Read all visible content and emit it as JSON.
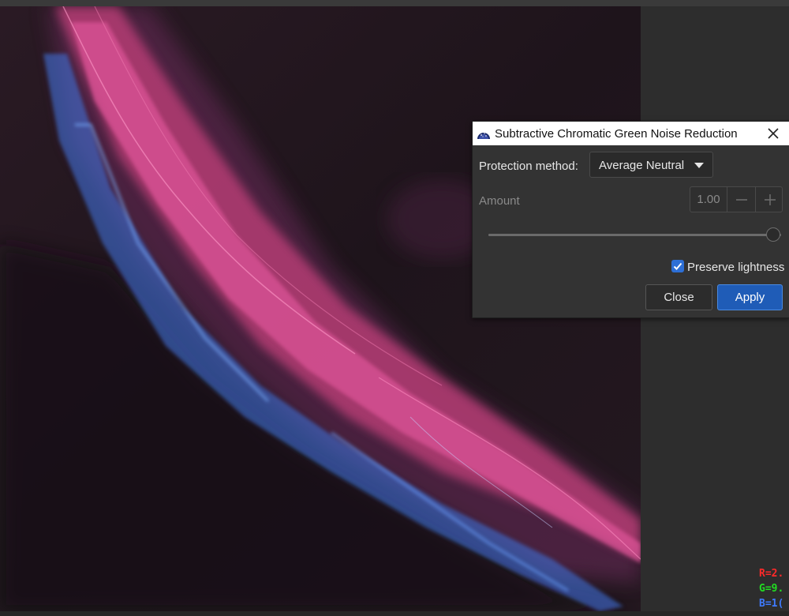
{
  "dialog": {
    "title": "Subtractive Chromatic Green Noise Reduction",
    "protection_label": "Protection method:",
    "protection_value": "Average Neutral",
    "amount_label": "Amount",
    "amount_value": "1.00",
    "amount_slider_fraction": 1.0,
    "preserve_label": "Preserve lightness",
    "preserve_checked": true,
    "close_label": "Close",
    "apply_label": "Apply"
  },
  "readout": {
    "r": "R=2.",
    "g": "G=9.",
    "b": "B=1(",
    "r_color": "#ff2a2a",
    "g_color": "#22dd22",
    "b_color": "#3f7bff"
  },
  "colors": {
    "accent": "#2d6fd6",
    "apply_button": "#1f5cb7"
  }
}
